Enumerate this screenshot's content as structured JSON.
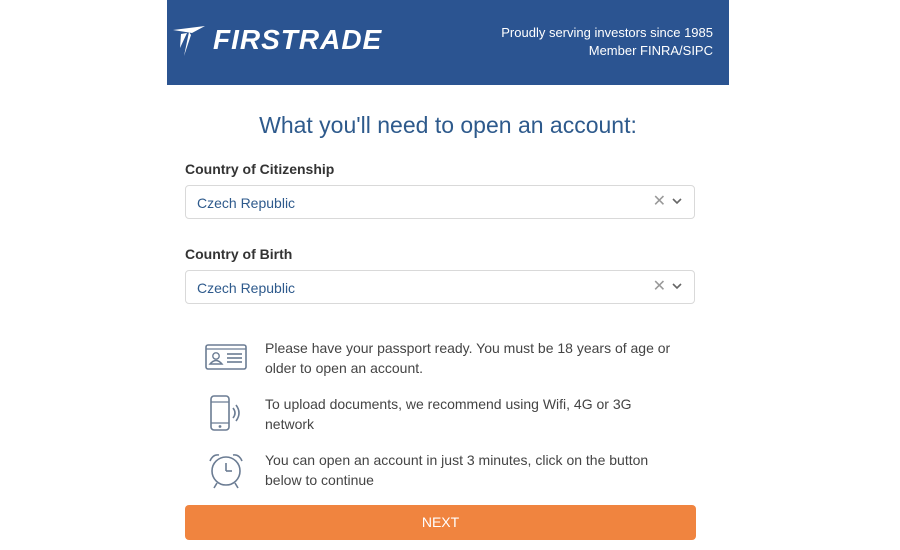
{
  "header": {
    "brand": "FIRSTRADE",
    "tagline_line1": "Proudly serving investors since 1985",
    "tagline_line2": "Member FINRA/SIPC",
    "bg_color": "#2b5491"
  },
  "main": {
    "title": "What you'll need to open an account:",
    "citizenship": {
      "label": "Country of Citizenship",
      "value": "Czech Republic",
      "clear_glyph": "✕"
    },
    "birth": {
      "label": "Country of Birth",
      "value": "Czech Republic",
      "clear_glyph": "✕"
    },
    "info_items": [
      {
        "icon": "id-card-icon",
        "text": "Please have your passport ready. You must be 18 years of age or older to open an account."
      },
      {
        "icon": "smartphone-signal-icon",
        "text": "To upload documents, we recommend using Wifi, 4G or 3G network"
      },
      {
        "icon": "alarm-clock-icon",
        "text": "You can open an account in just 3 minutes, click on the button below to continue"
      }
    ],
    "next_label": "NEXT",
    "accent_color": "#f0843f"
  }
}
